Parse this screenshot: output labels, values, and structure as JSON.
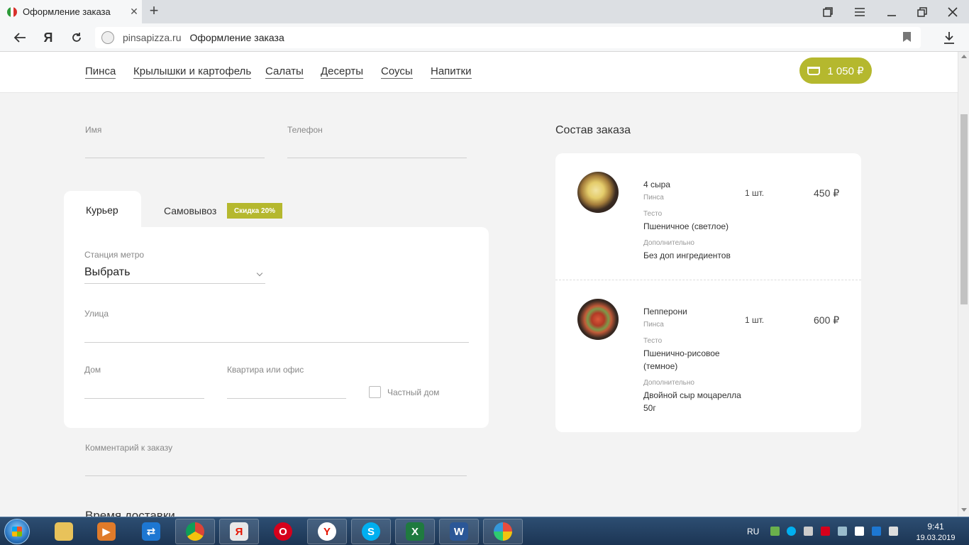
{
  "browser": {
    "tab_title": "Оформление заказа",
    "new_tab": "+",
    "domain": "pinsapizza.ru",
    "page_title": "Оформление заказа",
    "yandex_btn": "Я"
  },
  "site_nav": {
    "links": [
      "Пинса",
      "Крылышки и картофель",
      "Салаты",
      "Десерты",
      "Соусы",
      "Напитки"
    ],
    "cart_total": "1 050 ₽"
  },
  "contact": {
    "name_label": "Имя",
    "phone_label": "Телефон"
  },
  "delivery": {
    "tab_courier": "Курьер",
    "tab_pickup": "Самовывоз",
    "discount_badge": "Скидка 20%",
    "metro_label": "Станция метро",
    "metro_value": "Выбрать",
    "street_label": "Улица",
    "house_label": "Дом",
    "apartment_label": "Квартира или офис",
    "private_house_label": "Частный дом"
  },
  "comment_label": "Комментарий к заказу",
  "delivery_time_title": "Время доставки",
  "order": {
    "title": "Состав заказа",
    "items": [
      {
        "name": "4 сыра",
        "category": "Пинса",
        "dough_label": "Тесто",
        "dough": "Пшеничное (светлое)",
        "extra_label": "Дополнительно",
        "extra": "Без доп ингредиентов",
        "qty": "1 шт.",
        "price": "450 ₽"
      },
      {
        "name": "Пепперони",
        "category": "Пинса",
        "dough_label": "Тесто",
        "dough": "Пшенично-рисовое (темное)",
        "extra_label": "Дополнительно",
        "extra": "Двойной сыр моцарелла 50г",
        "qty": "1 шт.",
        "price": "600 ₽"
      }
    ]
  },
  "taskbar": {
    "lang": "RU",
    "time": "9:41",
    "date": "19.03.2019",
    "apps": [
      "explorer-icon",
      "media-player-icon",
      "teamviewer-icon",
      "chrome-icon",
      "yandex-browser-icon",
      "opera-icon",
      "yandex-icon",
      "skype-icon",
      "excel-icon",
      "word-icon",
      "paint-icon"
    ]
  },
  "colors": {
    "accent": "#b5b82e",
    "page_bg": "#f3f3f3"
  }
}
